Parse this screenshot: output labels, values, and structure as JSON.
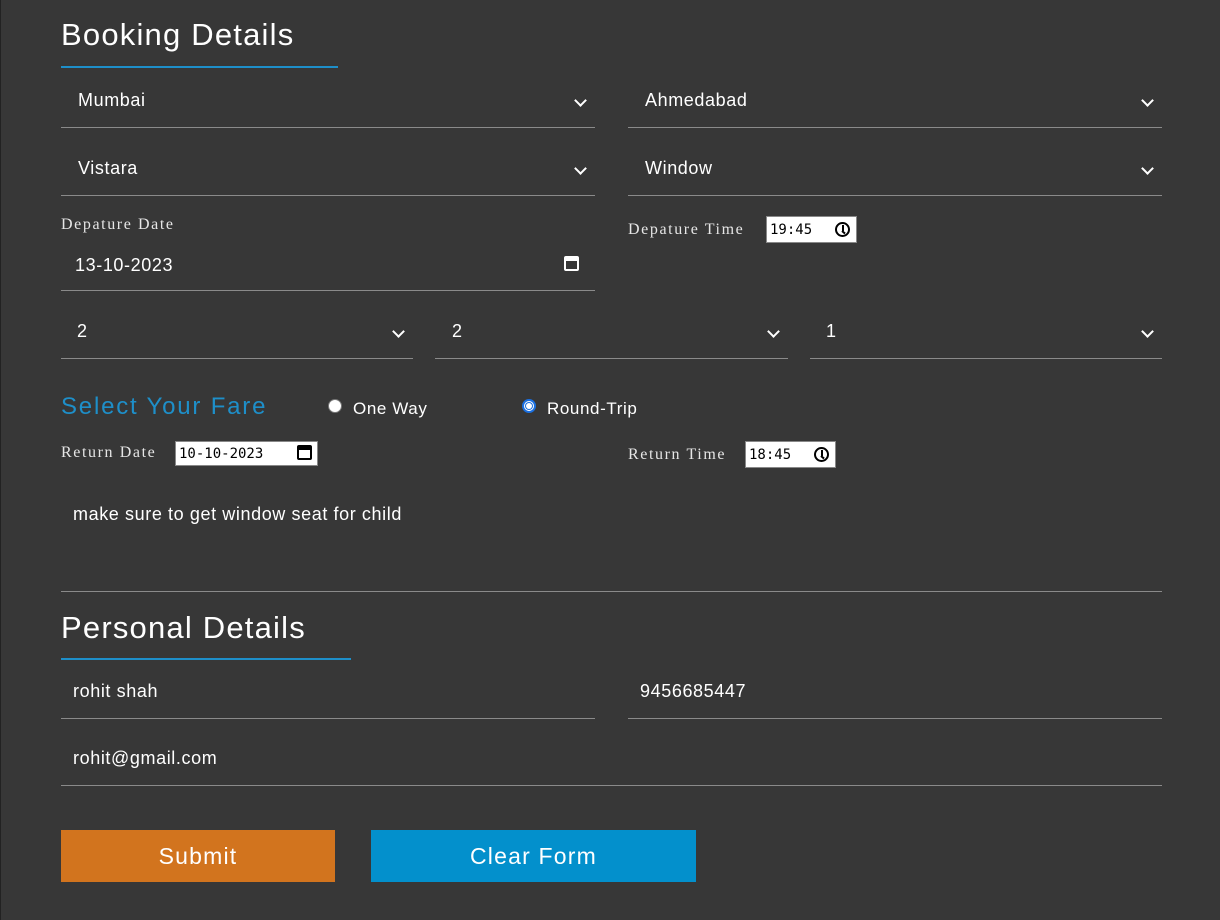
{
  "booking": {
    "title": "Booking Details",
    "from_city": "Mumbai",
    "to_city": "Ahmedabad",
    "airline": "Vistara",
    "seat": "Window",
    "departure_date_label": "Depature Date",
    "departure_date": "13-10-2023",
    "departure_time_label": "Depature Time",
    "departure_time": "19:45",
    "adults": "2",
    "children": "2",
    "infants": "1"
  },
  "fare": {
    "title": "Select Your Fare",
    "option_one_way": "One Way",
    "option_round_trip": "Round-Trip",
    "selected": "Round-Trip",
    "return_date_label": "Return Date",
    "return_date": "10-10-2023",
    "return_time_label": "Return Time",
    "return_time": "18:45"
  },
  "note": "make sure to get window seat for child",
  "personal": {
    "title": "Personal Details",
    "name": "rohit shah",
    "phone": "9456685447",
    "email": "rohit@gmail.com"
  },
  "buttons": {
    "submit": "Submit",
    "clear": "Clear Form"
  },
  "colors": {
    "background": "#373737",
    "accent": "#1e8fc9",
    "submit_bg": "#d2741e",
    "clear_bg": "#0390cc"
  }
}
